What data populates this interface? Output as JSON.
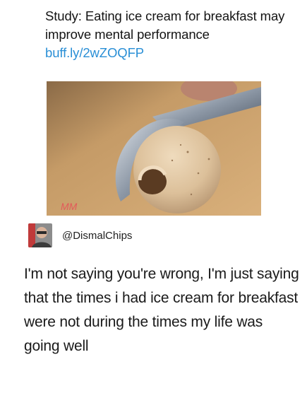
{
  "original_post": {
    "text": "Study: Eating ice cream for breakfast may improve mental performance",
    "link": "buff.ly/2wZOQFP"
  },
  "photo": {
    "icon": "ice-cream-scoop-photo",
    "watermark": "MM"
  },
  "reply": {
    "handle": "@DismalChips",
    "avatar_icon": "user-avatar-icon",
    "text": "I'm not saying you're wrong, I'm just saying that the times i had ice cream for breakfast were not during the times my life was going well"
  },
  "colors": {
    "link": "#2a8fd6",
    "text": "#141414",
    "background": "#ffffff"
  }
}
